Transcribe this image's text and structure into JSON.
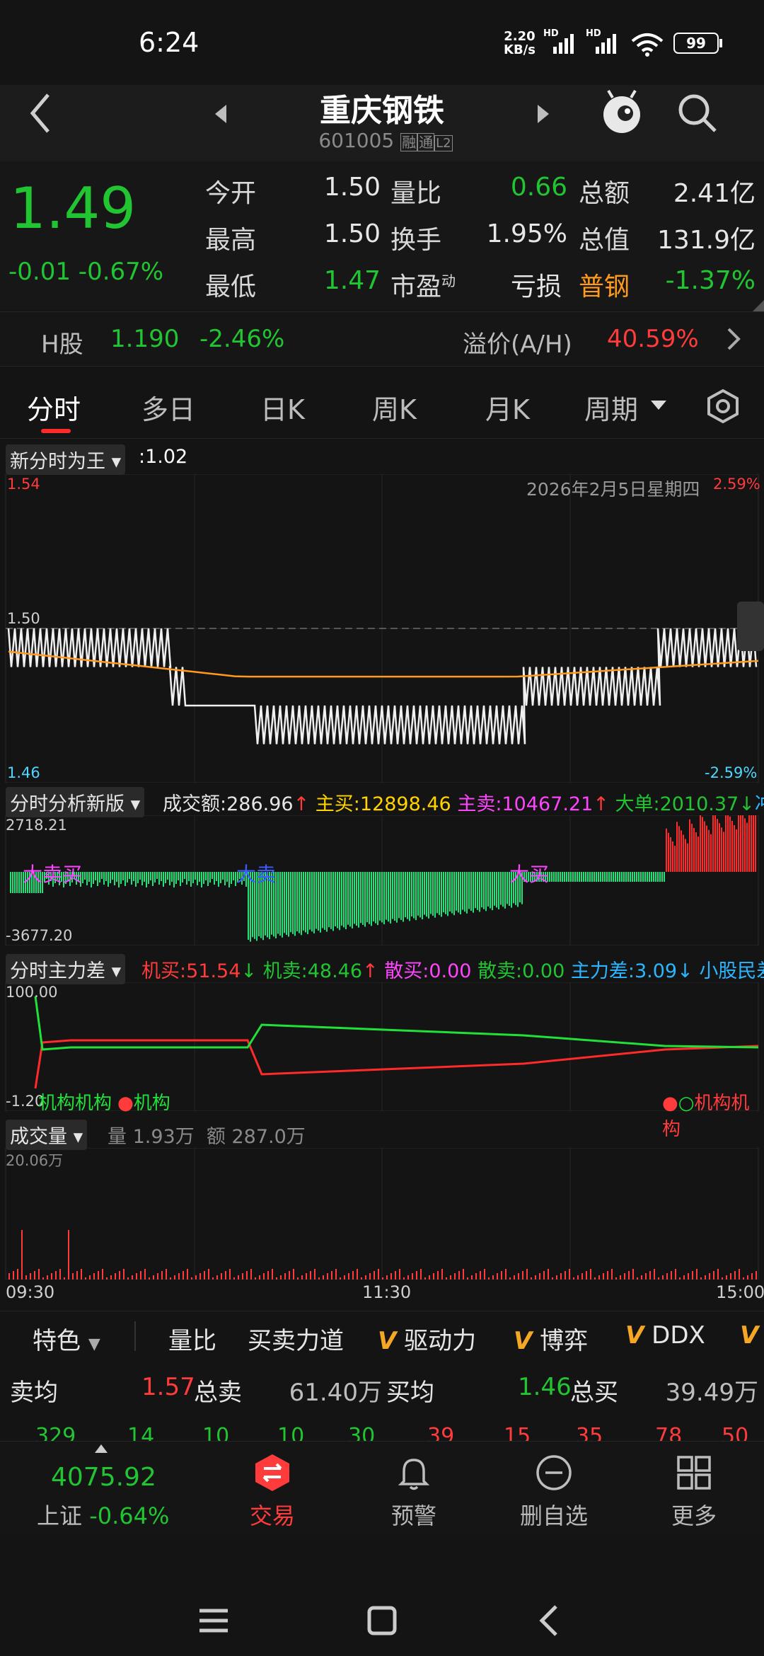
{
  "status_bar": {
    "time": "6:24",
    "net_speed_top": "2.20",
    "net_speed_bottom": "KB/s",
    "hd1": "HD",
    "hd2": "HD",
    "battery": "99"
  },
  "header": {
    "stock_name": "重庆钢铁",
    "stock_code": "601005",
    "tag1": "融",
    "tag2": "通",
    "tag3": "L2"
  },
  "quote": {
    "price": "1.49",
    "change": "-0.01",
    "change_pct": "-0.67%",
    "rows": [
      {
        "l1": "今开",
        "v1": "1.50",
        "l2": "量比",
        "v2": "0.66",
        "l3": "总额",
        "v3": "2.41亿"
      },
      {
        "l1": "最高",
        "v1": "1.50",
        "l2": "换手",
        "v2": "1.95%",
        "l3": "总值",
        "v3": "131.9亿"
      },
      {
        "l1": "最低",
        "v1": "1.47",
        "l2": "市盈",
        "l2sup": "动",
        "v2": "",
        "l3": "亏损",
        "l3b": "普钢",
        "v3": "-1.37%"
      }
    ]
  },
  "h_share": {
    "label": "H股",
    "price": "1.190",
    "pct": "-2.46%",
    "premium_label": "溢价(A/H)",
    "premium": "40.59%"
  },
  "tabs": [
    "分时",
    "多日",
    "日K",
    "周K",
    "月K",
    "周期"
  ],
  "chart1": {
    "title": "新分时为王",
    "value": ":1.02",
    "date_label": "2026年2月5日星期四",
    "y_high": "1.54",
    "y_mid": "1.50",
    "y_low": "1.46",
    "pct_high": "2.59%",
    "pct_low": "-2.59%"
  },
  "chart2": {
    "title": "分时分析新版",
    "stats": [
      {
        "text": "成交额:286.96",
        "arrow": "↑",
        "color": "#e6e6e6"
      },
      {
        "text": "主买:12898.46",
        "arrow": "",
        "color": "#ffd400"
      },
      {
        "text": "主卖:10467.21",
        "arrow": "↑",
        "color": "#ff44ff"
      },
      {
        "text": "大单:2010.37",
        "arrow": "↓",
        "color": "#21c531"
      },
      {
        "text": "冲涨",
        "arrow": "",
        "color": "#2ab7ff"
      }
    ],
    "y_high": "2718.21",
    "y_low": "-3677.20",
    "marks": [
      "大卖买",
      "大卖",
      "大买"
    ]
  },
  "chart3": {
    "title": "分时主力差",
    "stats": [
      {
        "text": "机买:51.54",
        "arrow": "↓",
        "color": "#ff3b3b"
      },
      {
        "text": "机卖:48.46",
        "arrow": "↑",
        "color": "#21c531"
      },
      {
        "text": "散买:0.00",
        "arrow": "",
        "color": "#ff44ff"
      },
      {
        "text": "散卖:0.00",
        "arrow": "",
        "color": "#21c531"
      },
      {
        "text": "主力差:3.09",
        "arrow": "↓",
        "color": "#2ab7ff"
      },
      {
        "text": "小股民差",
        "arrow": "",
        "color": "#2ab7ff"
      }
    ],
    "y_high": "100.00",
    "y_low": "-1.20",
    "marks_left": "机构机构",
    "mark_mid": "机构",
    "marks_right": "机构机构"
  },
  "chart4": {
    "title": "成交量",
    "vol": "量 1.93万",
    "amt": "额 287.0万",
    "y_high": "20.06万",
    "times": [
      "09:30",
      "11:30",
      "15:00"
    ]
  },
  "features": {
    "dropdown": "特色",
    "items": [
      "量比",
      "买卖力道",
      "驱动力",
      "博弈",
      "DDX"
    ]
  },
  "order_book": {
    "sell_avg_label": "卖均",
    "sell_avg": "1.57",
    "sell_total_label": "总卖",
    "sell_total": "61.40万",
    "buy_avg_label": "买均",
    "buy_avg": "1.46",
    "buy_total_label": "总买",
    "buy_total": "39.49万",
    "sell_row": [
      "329",
      "14",
      "10",
      "10",
      "30"
    ],
    "buy_row": [
      "39",
      "15",
      "35",
      "78",
      "50"
    ]
  },
  "bottom": {
    "index_value": "4075.92",
    "index_name": "上证",
    "index_pct": "-0.64%",
    "trade": "交易",
    "alert": "预警",
    "remove": "删自选",
    "more": "更多"
  },
  "colors": {
    "up": "#ff3b3b",
    "down": "#21c531",
    "avg_line": "#ff9a1e",
    "bg": "#141414"
  }
}
